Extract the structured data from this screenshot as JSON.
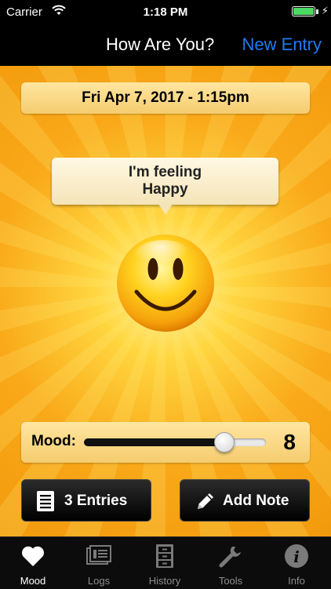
{
  "status_bar": {
    "carrier": "Carrier",
    "time": "1:18 PM"
  },
  "nav": {
    "title": "How Are You?",
    "new_entry": "New Entry"
  },
  "entry": {
    "datetime": "Fri Apr 7, 2017 - 1:15pm"
  },
  "feeling": {
    "line1": "I'm feeling",
    "line2": "Happy"
  },
  "mood": {
    "label": "Mood:",
    "value": "8",
    "slider_fraction": 0.77
  },
  "buttons": {
    "entries": "3 Entries",
    "add_note": "Add Note"
  },
  "tabs": [
    {
      "label": "Mood",
      "icon": "heart-icon",
      "active": true
    },
    {
      "label": "Logs",
      "icon": "logs-icon",
      "active": false
    },
    {
      "label": "History",
      "icon": "cabinet-icon",
      "active": false
    },
    {
      "label": "Tools",
      "icon": "wrench-icon",
      "active": false
    },
    {
      "label": "Info",
      "icon": "info-icon",
      "active": false
    }
  ],
  "colors": {
    "accent": "#1e7bf0",
    "battery": "#4cd964",
    "background": "#f9a919"
  }
}
